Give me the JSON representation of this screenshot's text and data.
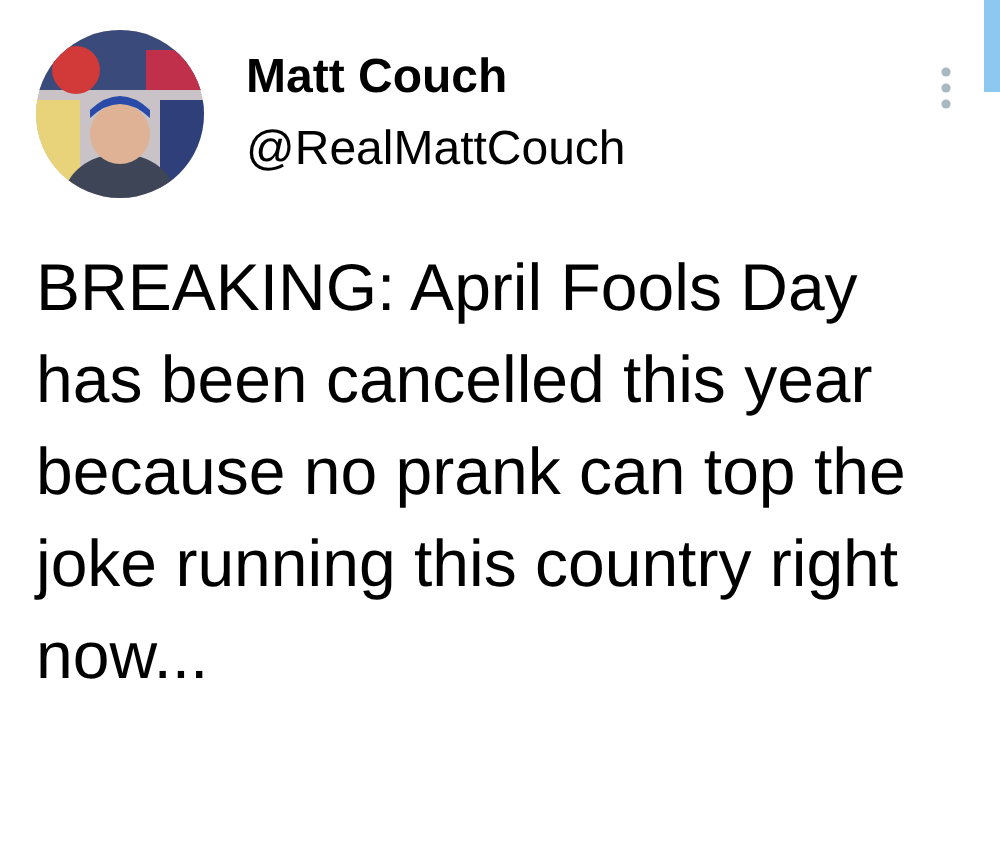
{
  "author": {
    "name": "Matt Couch",
    "handle": "@RealMattCouch"
  },
  "tweet": {
    "text": "BREAKING: April Fools Day has been cancelled this year because no prank can top the joke running this country right now..."
  }
}
